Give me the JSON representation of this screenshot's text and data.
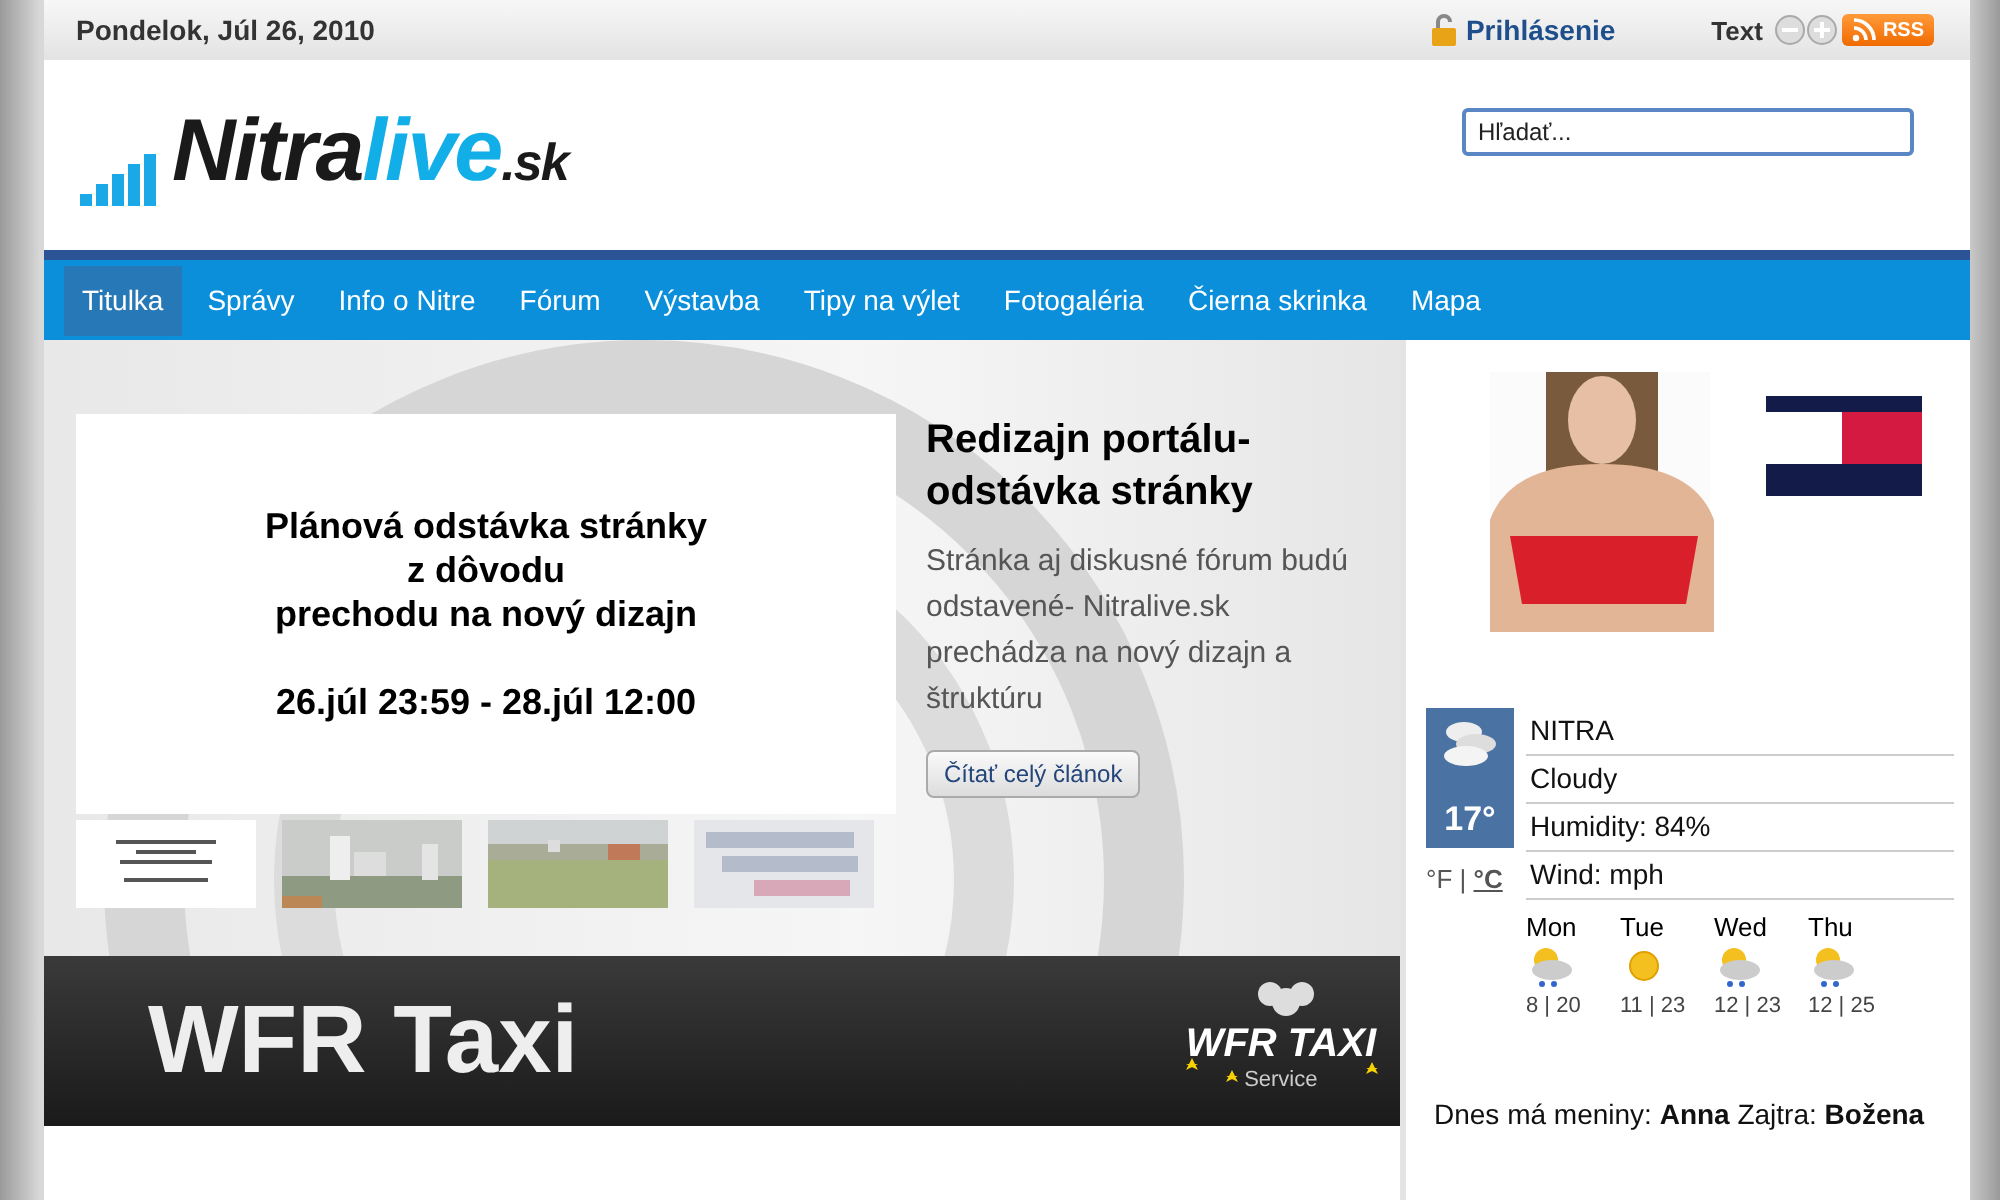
{
  "top_bar": {
    "date": "Pondelok, Júl 26, 2010",
    "login": "Prihlásenie",
    "text_size_label": "Text",
    "rss": "RSS"
  },
  "header": {
    "logo_main": "Nitra",
    "logo_accent": "live",
    "logo_suffix": ".sk",
    "search": {
      "placeholder": "Hľadať..."
    }
  },
  "nav": [
    {
      "label": "Titulka",
      "selected": true
    },
    {
      "label": "Správy",
      "selected": false
    },
    {
      "label": "Info o Nitre",
      "selected": false
    },
    {
      "label": "Fórum",
      "selected": false
    },
    {
      "label": "Výstavba",
      "selected": false
    },
    {
      "label": "Tipy na výlet",
      "selected": false
    },
    {
      "label": "Fotogaléria",
      "selected": false
    },
    {
      "label": "Čierna skrinka",
      "selected": false
    },
    {
      "label": "Mapa",
      "selected": false
    }
  ],
  "feature": {
    "slide_lines": [
      "Plánová odstávka stránky",
      "z dôvodu",
      "prechodu na nový dizajn"
    ],
    "slide_dates": "26.júl 23:59 - 28.júl 12:00",
    "title": "Redizajn portálu- odstávka stránky",
    "summary": "Stránka aj diskusné fórum budú odstavené- Nitralive.sk prechádza na nový dizajn a štruktúru",
    "read_more": "Čítať celý článok",
    "thumbnails": [
      {
        "kind": "picture"
      },
      {
        "kind": "picture"
      },
      {
        "kind": "picture"
      },
      {
        "kind": "picture"
      }
    ]
  },
  "banner": {
    "title": "WFR Taxi",
    "logo": "WFR TAXI",
    "logo_sub": "Service"
  },
  "sidebar": {
    "ad": {
      "kind": "picture"
    },
    "weather": {
      "temp": "17°",
      "city": "NITRA",
      "condition": "Cloudy",
      "humidity": "Humidity: 84%",
      "wind": "Wind: mph",
      "separator": "|",
      "units": [
        {
          "label": "°F",
          "selected": false
        },
        {
          "label": "°C",
          "selected": true
        }
      ],
      "forecast": [
        {
          "day": "Mon",
          "kind": "rain",
          "temps": "8 | 20"
        },
        {
          "day": "Tue",
          "kind": "sun",
          "temps": "11 | 23"
        },
        {
          "day": "Wed",
          "kind": "rain",
          "temps": "12 | 23"
        },
        {
          "day": "Thu",
          "kind": "rain",
          "temps": "12 | 25"
        }
      ]
    },
    "namedays": "Dnes má meniny: **Anna** Zajtra: **Božena**"
  }
}
